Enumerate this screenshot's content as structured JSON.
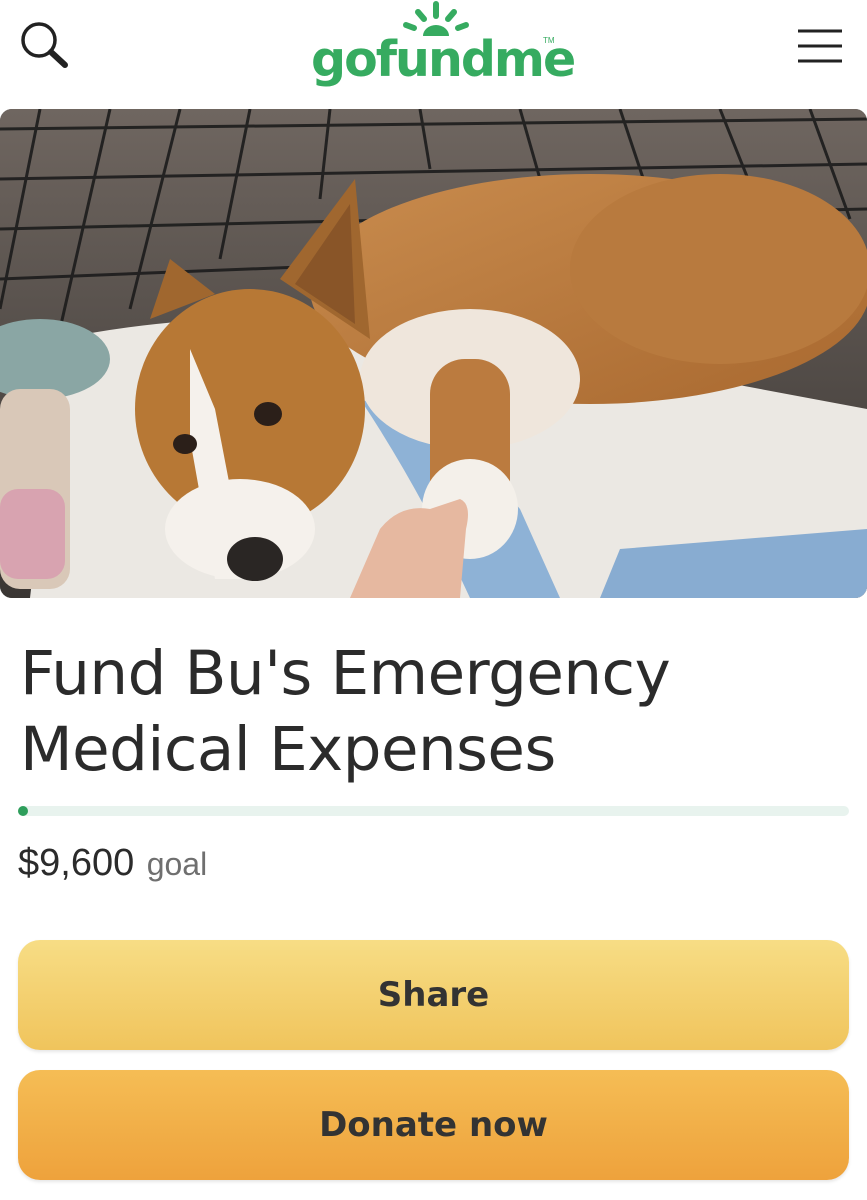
{
  "header": {
    "logo_text": "gofundme",
    "logo_tm": "TM",
    "search_icon": "search-icon",
    "menu_icon": "hamburger-menu-icon"
  },
  "hero": {
    "image": "photo of a corgi lying on a blanket with a hand touching its paw"
  },
  "campaign": {
    "title": "Fund Bu's Emergency Medical Expenses",
    "progress_fraction": 0.01,
    "goal_amount": "$9,600",
    "goal_label": "goal"
  },
  "actions": {
    "share_label": "Share",
    "donate_label": "Donate now"
  },
  "colors": {
    "brand_green": "#36ab60",
    "share_yellow": "#f3cf6c",
    "donate_orange": "#f0ac44"
  }
}
